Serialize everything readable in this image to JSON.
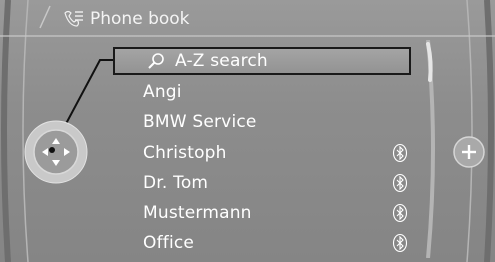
{
  "header": {
    "title": "Phone book",
    "icon": "phone-book-icon"
  },
  "search": {
    "label": "A-Z search",
    "icon": "magnifier-icon"
  },
  "contacts": [
    {
      "name": "Angi",
      "bluetooth": false
    },
    {
      "name": "BMW Service",
      "bluetooth": false
    },
    {
      "name": "Christoph",
      "bluetooth": true
    },
    {
      "name": "Dr. Tom",
      "bluetooth": true
    },
    {
      "name": "Mustermann",
      "bluetooth": true
    },
    {
      "name": "Office",
      "bluetooth": true
    }
  ],
  "colors": {
    "background": "#8f8f8f",
    "text": "#ffffff",
    "highlight_border": "#1a1a1a"
  },
  "controls": {
    "controller_icon": "controller-knob-icon",
    "plus_icon": "plus-icon",
    "bluetooth_icon": "bluetooth-icon"
  }
}
